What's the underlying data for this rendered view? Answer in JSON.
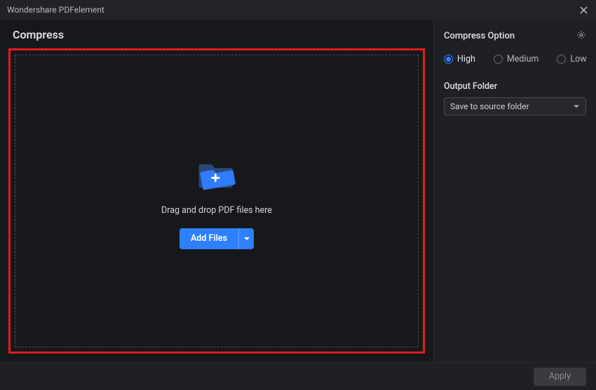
{
  "titlebar": {
    "app_name": "Wondershare PDFelement"
  },
  "main": {
    "title": "Compress",
    "drop_text": "Drag and drop PDF files here",
    "add_files_label": "Add Files"
  },
  "sidebar": {
    "title": "Compress Option",
    "radios": {
      "high": "High",
      "medium": "Medium",
      "low": "Low"
    },
    "output_folder_label": "Output Folder",
    "output_folder_value": "Save to source folder"
  },
  "footer": {
    "apply_label": "Apply"
  },
  "colors": {
    "accent": "#2f80ff",
    "highlight": "#e11b1b"
  }
}
